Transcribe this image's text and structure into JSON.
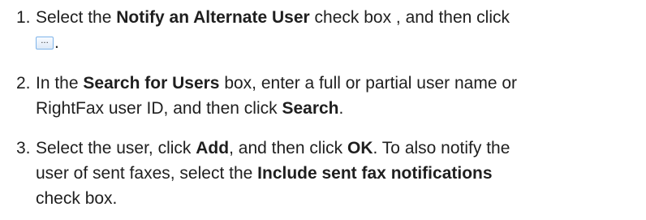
{
  "steps": [
    {
      "number": "1.",
      "text_before": "Select the ",
      "bold_term": "Notify an Alternate User",
      "text_after": " check box , and then click",
      "button_glyph": "...",
      "period": "."
    },
    {
      "number": "2.",
      "l1_a": "In the ",
      "l1_b": "Search for Users",
      "l1_c": " box, enter a full or partial user name or",
      "l2_a": "RightFax user ID, and then click ",
      "l2_b": "Search",
      "l2_c": "."
    },
    {
      "number": "3.",
      "l1_a": "Select the user, click ",
      "l1_b": "Add",
      "l1_c": ", and then click ",
      "l1_d": "OK",
      "l1_e": ". To also notify the",
      "l2_a": "user of sent faxes, select the ",
      "l2_b": "Include sent fax notifications",
      "l3_a": "check box."
    }
  ]
}
